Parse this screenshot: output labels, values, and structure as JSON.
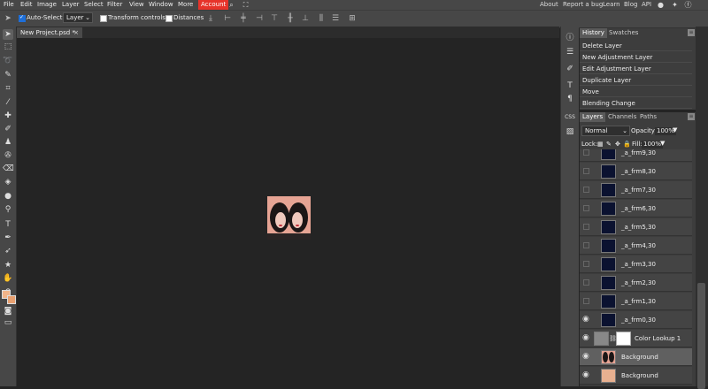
{
  "menubar": {
    "items": [
      "File",
      "Edit",
      "Image",
      "Layer",
      "Select",
      "Filter",
      "View",
      "Window",
      "More"
    ],
    "account": "Account",
    "right_links": [
      "About",
      "Report a bug",
      "Learn",
      "Blog",
      "API"
    ],
    "icons": [
      "search-icon",
      "fullscreen-icon",
      "reddit-icon",
      "twitter-icon",
      "facebook-icon"
    ]
  },
  "options": {
    "auto_select_label": "Auto-Select",
    "auto_select_checked": true,
    "auto_select_target": "Layer",
    "transform_controls_label": "Transform controls",
    "distances_label": "Distances"
  },
  "document": {
    "tab_label": "New Project.psd *"
  },
  "history": {
    "tabs": [
      "History",
      "Swatches"
    ],
    "items": [
      "Delete Layer",
      "New Adjustment Layer",
      "Edit Adjustment Layer",
      "Duplicate Layer",
      "Move",
      "Blending Change"
    ]
  },
  "layers_panel": {
    "tabs": [
      "Layers",
      "Channels",
      "Paths"
    ],
    "blend_mode": "Normal",
    "opacity_label": "Opacity:",
    "opacity_value": "100%",
    "lock_label": "Lock:",
    "fill_label": "Fill:",
    "fill_value": "100%",
    "layers": [
      {
        "name": "_a_frm9,30",
        "visible": false,
        "kind": "stars"
      },
      {
        "name": "_a_frm8,30",
        "visible": false,
        "kind": "stars"
      },
      {
        "name": "_a_frm7,30",
        "visible": false,
        "kind": "stars"
      },
      {
        "name": "_a_frm6,30",
        "visible": false,
        "kind": "stars"
      },
      {
        "name": "_a_frm5,30",
        "visible": false,
        "kind": "stars"
      },
      {
        "name": "_a_frm4,30",
        "visible": false,
        "kind": "stars"
      },
      {
        "name": "_a_frm3,30",
        "visible": false,
        "kind": "stars"
      },
      {
        "name": "_a_frm2,30",
        "visible": false,
        "kind": "stars"
      },
      {
        "name": "_a_frm1,30",
        "visible": false,
        "kind": "stars"
      },
      {
        "name": "_a_frm0,30",
        "visible": true,
        "kind": "stars"
      },
      {
        "name": "Color Lookup 1",
        "visible": true,
        "kind": "adjustment"
      },
      {
        "name": "Background",
        "visible": true,
        "kind": "photo",
        "selected": true
      },
      {
        "name": "Background",
        "visible": true,
        "kind": "fill"
      }
    ]
  },
  "colors": {
    "accent": "#e6332a",
    "foreground_swatch": "#f2b58a",
    "background_swatch": "#e8a070",
    "selected_layer": "#606060"
  }
}
